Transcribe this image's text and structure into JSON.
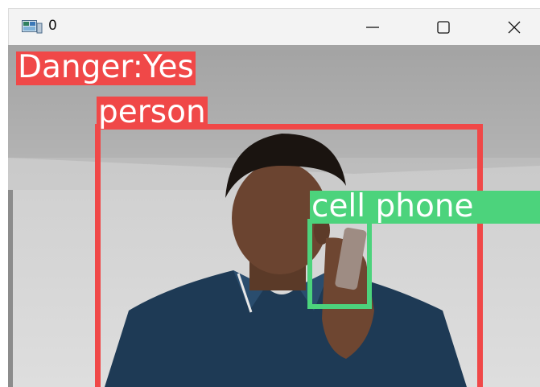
{
  "window": {
    "title": "0",
    "app_icon": "opencv-window-icon",
    "controls": {
      "minimize_icon": "minimize-icon",
      "maximize_icon": "maximize-icon",
      "close_icon": "close-icon"
    }
  },
  "overlay": {
    "status_label": "Danger:Yes",
    "status_color": "#f04848",
    "detections": [
      {
        "label": "person",
        "color": "#f04848"
      },
      {
        "label": "cell phone",
        "color": "#4cd37c"
      }
    ]
  }
}
